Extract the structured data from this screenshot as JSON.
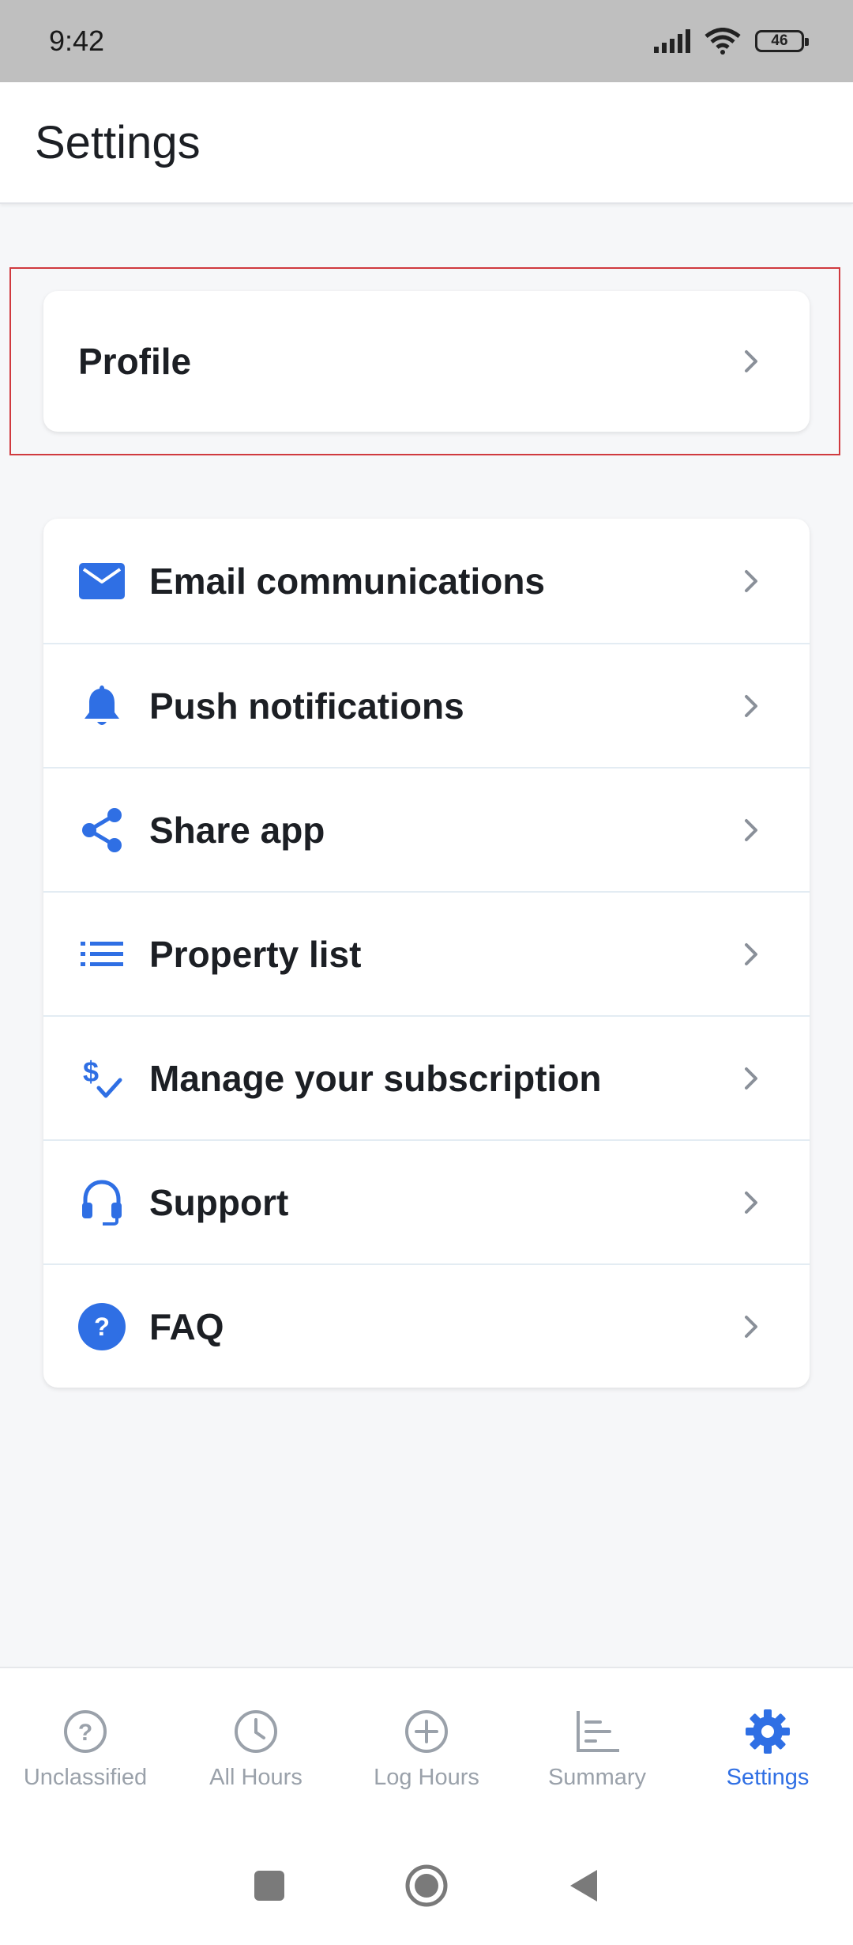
{
  "status_bar": {
    "time": "9:42",
    "battery": "46"
  },
  "header": {
    "title": "Settings"
  },
  "profile": {
    "label": "Profile",
    "icon": "chevron-right-icon"
  },
  "menu": {
    "items": [
      {
        "label": "Email communications",
        "icon": "email-icon"
      },
      {
        "label": "Push notifications",
        "icon": "bell-icon"
      },
      {
        "label": "Share app",
        "icon": "share-icon"
      },
      {
        "label": "Property list",
        "icon": "list-icon"
      },
      {
        "label": "Manage your subscription",
        "icon": "dollar-check-icon"
      },
      {
        "label": "Support",
        "icon": "headset-icon"
      },
      {
        "label": "FAQ",
        "icon": "question-circle-icon"
      }
    ]
  },
  "bottom_nav": {
    "tabs": [
      {
        "label": "Unclassified",
        "icon": "question-outline-icon",
        "active": false
      },
      {
        "label": "All Hours",
        "icon": "clock-icon",
        "active": false
      },
      {
        "label": "Log Hours",
        "icon": "plus-circle-icon",
        "active": false
      },
      {
        "label": "Summary",
        "icon": "bar-chart-icon",
        "active": false
      },
      {
        "label": "Settings",
        "icon": "gear-icon",
        "active": true
      }
    ]
  },
  "colors": {
    "accent": "#2f6fe4",
    "highlight_border": "#d03a3f",
    "inactive": "#9aa1aa"
  }
}
